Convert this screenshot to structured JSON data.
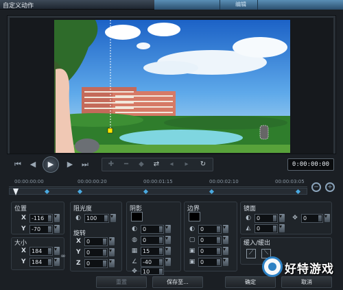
{
  "window": {
    "title": "自定义动作",
    "tab_label": "编辑"
  },
  "preview": {
    "scene_description_icon": "landscape-image"
  },
  "controls": {
    "buttons": [
      "go-start-icon",
      "prev-frame-icon",
      "play-icon",
      "next-frame-icon",
      "go-end-icon"
    ],
    "toolbar": [
      "add-keyframe-icon",
      "remove-keyframe-icon",
      "reverse-keyframe-icon",
      "swap-icon",
      "move-left-icon",
      "move-right-icon",
      "reset-icon"
    ],
    "timecode": "0:00:00:00"
  },
  "timeline": {
    "ticks": [
      "00:00:00:00",
      "00:00:00:20",
      "00:00:01:15",
      "00:00:02:10",
      "00:00:03:05"
    ]
  },
  "params": {
    "position": {
      "label": "位置",
      "x_axis": "X",
      "x": "-116",
      "y_axis": "Y",
      "y": "-70"
    },
    "size": {
      "label": "大小",
      "x_axis": "X",
      "x": "184",
      "y_axis": "Y",
      "y": "184"
    },
    "opacity": {
      "label": "阻光度",
      "value": "100"
    },
    "rotation": {
      "label": "旋转",
      "x_axis": "X",
      "x": "0",
      "y_axis": "Y",
      "y": "0",
      "z_axis": "Z",
      "z": "0"
    },
    "shadow": {
      "label": "阴影",
      "v1": "0",
      "v2": "0",
      "v3": "15",
      "v4": "-40",
      "v5": "10"
    },
    "border": {
      "label": "边界",
      "v1": "0",
      "v2": "0",
      "v3": "0",
      "v4": "0"
    },
    "mirror": {
      "label": "镜面",
      "v1": "0",
      "v2": "0",
      "v3": "0"
    },
    "fade": {
      "label": "缓入/缓出"
    }
  },
  "footer": {
    "reset": "重置",
    "save": "保存至...",
    "ok": "确定",
    "cancel": "取消"
  },
  "watermark": {
    "text": "好特游戏"
  }
}
